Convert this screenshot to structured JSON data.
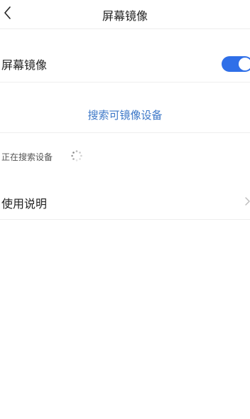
{
  "nav": {
    "title": "屏幕镜像",
    "back_icon": "chevron-left-icon"
  },
  "mirror": {
    "label": "屏幕镜像",
    "toggle_on": true,
    "toggle_color": "#2f6fe8"
  },
  "search": {
    "label": "搜索可镜像设备",
    "color": "#3d78c8"
  },
  "status": {
    "text": "正在搜索设备",
    "icon": "loading-spinner-icon"
  },
  "help": {
    "label": "使用说明",
    "icon": "chevron-right-icon"
  }
}
